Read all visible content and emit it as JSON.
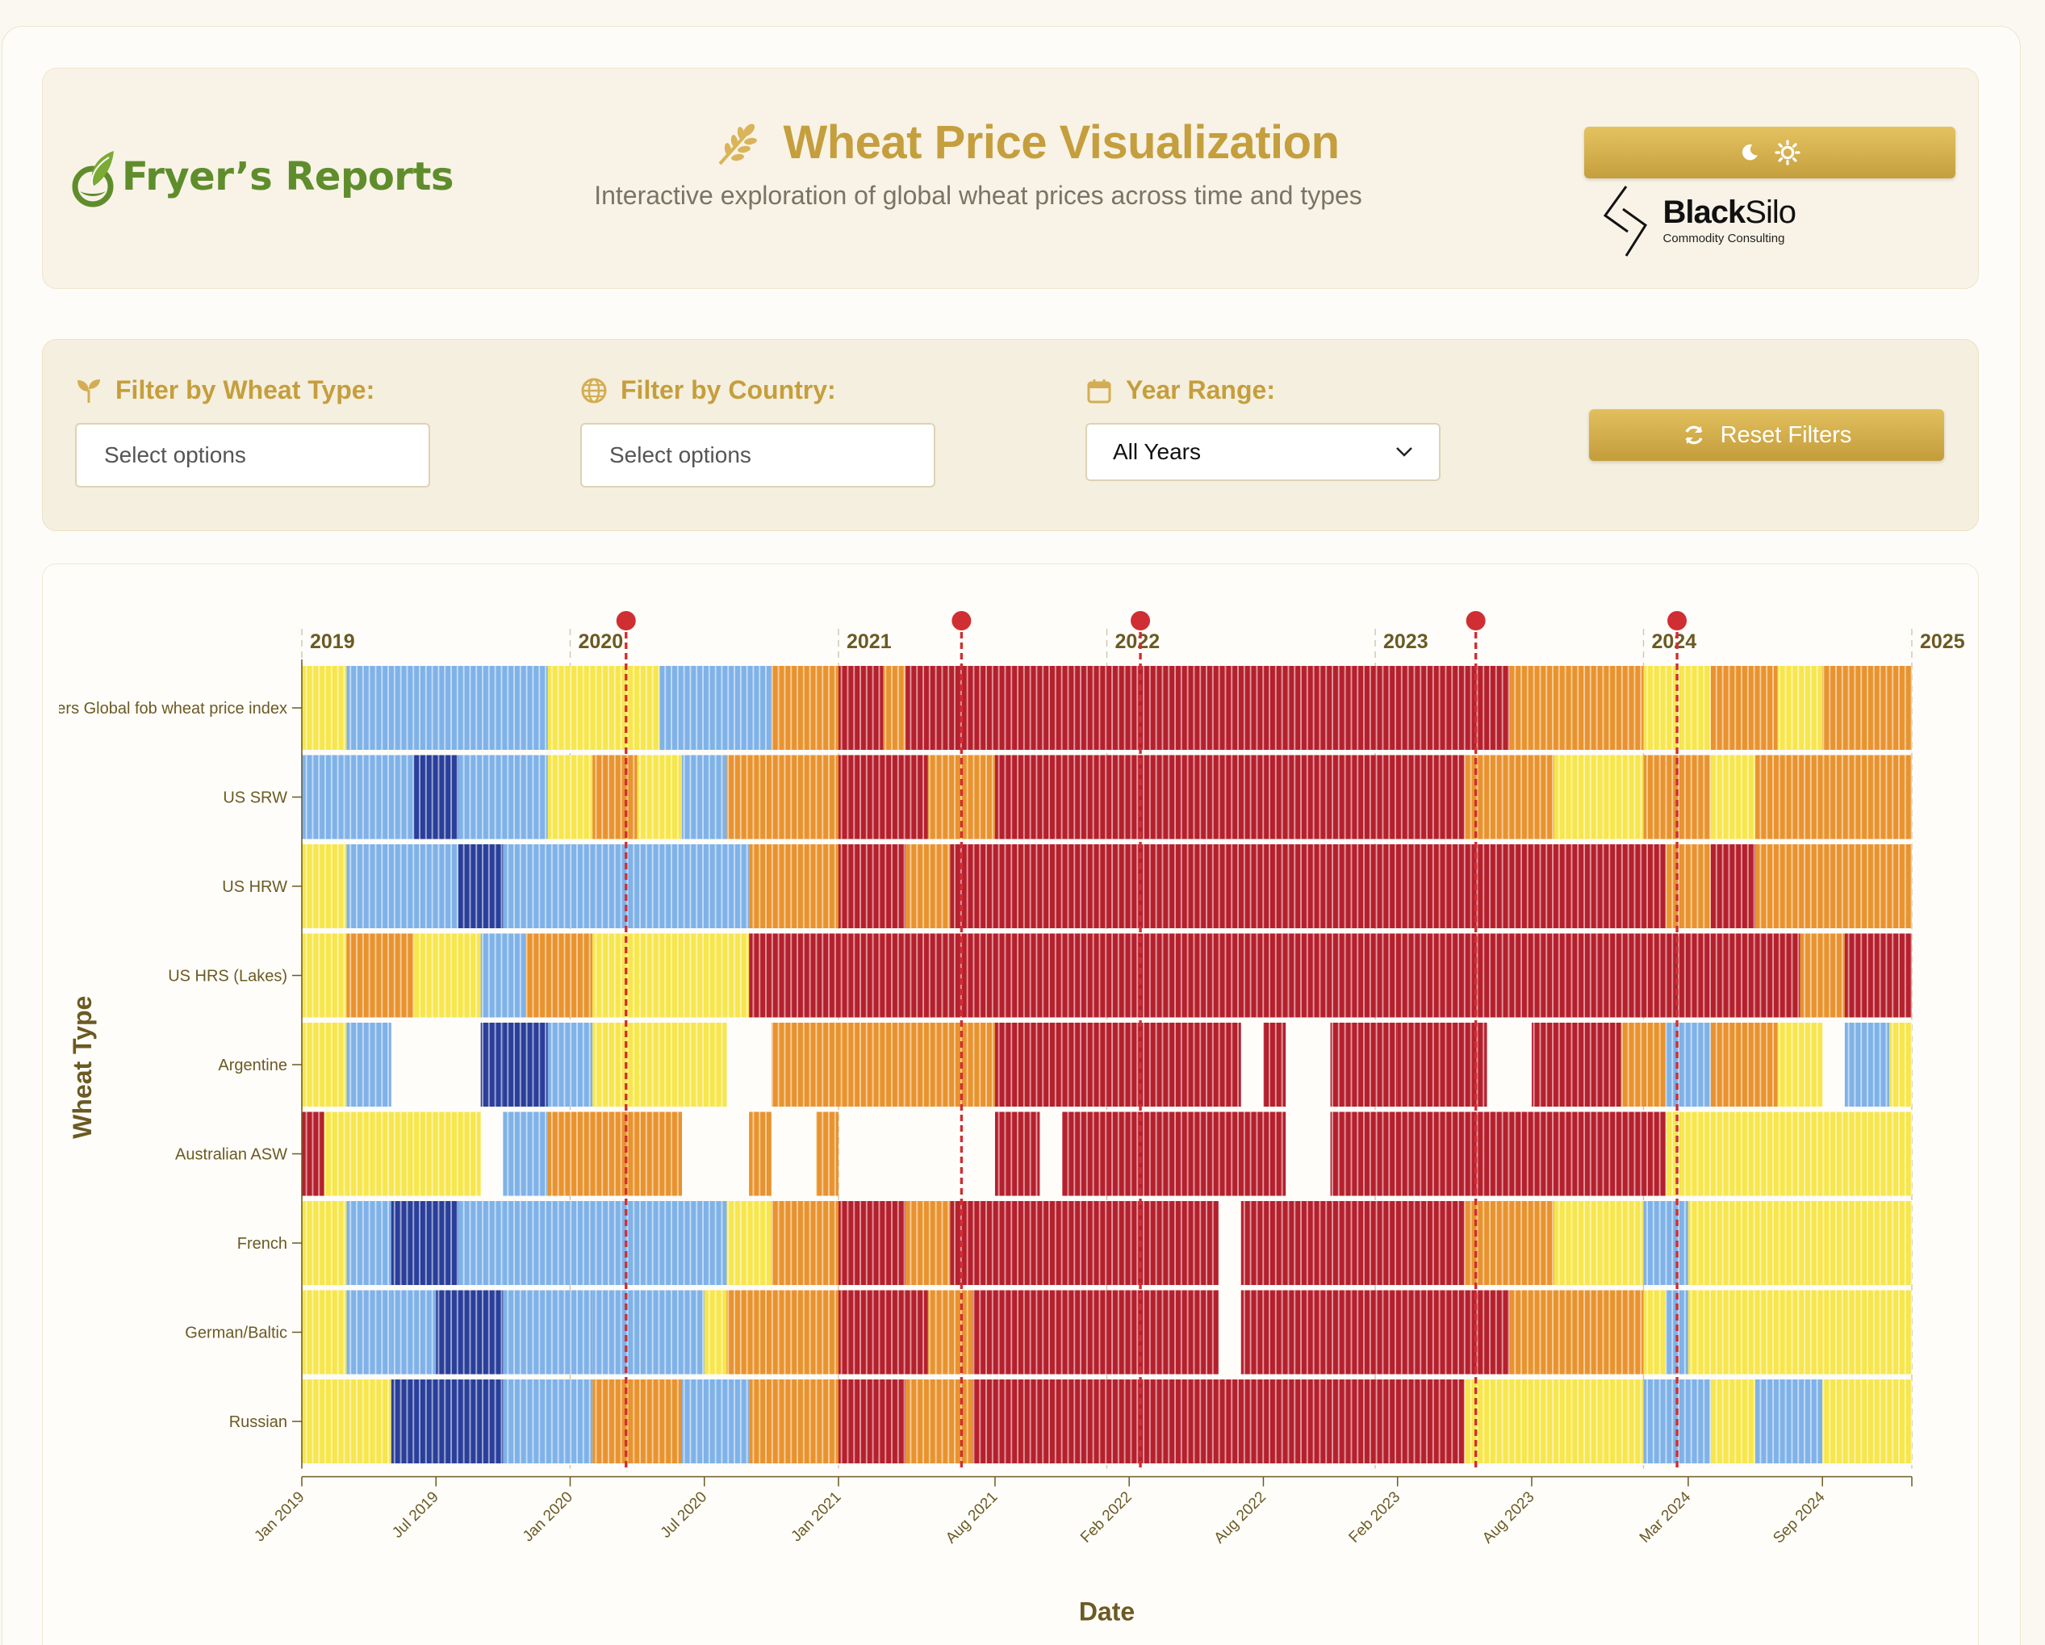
{
  "header": {
    "brand": "Fryer’s Reports",
    "title": "Wheat Price Visualization",
    "subtitle": "Interactive exploration of global wheat prices across time and types",
    "theme_toggle": {
      "moon_icon": "moon-icon",
      "sun_icon": "sun-icon"
    },
    "partner": {
      "name_bold": "Black",
      "name_light": "Silo",
      "tagline": "Commodity Consulting"
    }
  },
  "filters": {
    "wheat_type": {
      "label": "Filter by Wheat Type:",
      "placeholder": "Select options",
      "icon": "seedling-icon"
    },
    "country": {
      "label": "Filter by Country:",
      "placeholder": "Select options",
      "icon": "globe-icon"
    },
    "year_range": {
      "label": "Year Range:",
      "selected": "All Years",
      "icon": "calendar-icon"
    },
    "reset_label": "Reset Filters"
  },
  "colors": {
    "very_low": "#2a3f9a",
    "low": "#7fb2e8",
    "mid": "#f7e64c",
    "high": "#e9932e",
    "very_high": "#b5202d",
    "event_marker": "#cf2f33",
    "accent": "#c59e3d"
  },
  "chart_data": {
    "type": "heatmap",
    "ylabel": "Wheat Type",
    "xlabel": "Date",
    "rows": [
      "Fryers Global fob wheat price index",
      "US SRW",
      "US HRW",
      "US HRS (Lakes)",
      "Argentine",
      "Australian ASW",
      "French",
      "German/Baltic",
      "Russian"
    ],
    "x_range": [
      "2019-01",
      "2024-12"
    ],
    "year_labels": [
      "2019",
      "2020",
      "2021",
      "2022",
      "2023",
      "2024",
      "2025"
    ],
    "x_ticks": [
      "Jan 2019",
      "Jul 2019",
      "Jan 2020",
      "Jul 2020",
      "Jan 2021",
      "Aug 2021",
      "Feb 2022",
      "Aug 2022",
      "Feb 2023",
      "Aug 2023",
      "Mar 2024",
      "Sep 2024"
    ],
    "events": [
      "2020-03",
      "2021-06",
      "2022-02",
      "2023-05",
      "2024-02"
    ],
    "scale": [
      "very_low",
      "low",
      "mid",
      "high",
      "very_high"
    ],
    "segments": [
      [
        [
          "2019-01",
          "2019-03",
          "mid"
        ],
        [
          "2019-03",
          "2019-12",
          "low"
        ],
        [
          "2019-12",
          "2020-05",
          "mid"
        ],
        [
          "2020-05",
          "2020-10",
          "low"
        ],
        [
          "2020-10",
          "2021-01",
          "high"
        ],
        [
          "2021-01",
          "2021-03",
          "very_high"
        ],
        [
          "2021-03",
          "2021-04",
          "high"
        ],
        [
          "2021-04",
          "2023-07",
          "very_high"
        ],
        [
          "2023-07",
          "2024-01",
          "high"
        ],
        [
          "2024-01",
          "2024-04",
          "mid"
        ],
        [
          "2024-04",
          "2024-07",
          "high"
        ],
        [
          "2024-07",
          "2024-09",
          "mid"
        ],
        [
          "2024-09",
          "2025-01",
          "high"
        ]
      ],
      [
        [
          "2019-01",
          "2019-03",
          "low"
        ],
        [
          "2019-03",
          "2019-06",
          "low"
        ],
        [
          "2019-06",
          "2019-08",
          "very_low"
        ],
        [
          "2019-08",
          "2019-12",
          "low"
        ],
        [
          "2019-12",
          "2020-02",
          "mid"
        ],
        [
          "2020-02",
          "2020-04",
          "high"
        ],
        [
          "2020-04",
          "2020-06",
          "mid"
        ],
        [
          "2020-06",
          "2020-08",
          "low"
        ],
        [
          "2020-08",
          "2021-01",
          "high"
        ],
        [
          "2021-01",
          "2021-05",
          "very_high"
        ],
        [
          "2021-05",
          "2021-08",
          "high"
        ],
        [
          "2021-08",
          "2023-05",
          "very_high"
        ],
        [
          "2023-05",
          "2023-09",
          "high"
        ],
        [
          "2023-09",
          "2024-01",
          "mid"
        ],
        [
          "2024-01",
          "2024-04",
          "high"
        ],
        [
          "2024-04",
          "2024-06",
          "mid"
        ],
        [
          "2024-06",
          "2025-01",
          "high"
        ]
      ],
      [
        [
          "2019-01",
          "2019-03",
          "mid"
        ],
        [
          "2019-03",
          "2019-08",
          "low"
        ],
        [
          "2019-08",
          "2019-10",
          "very_low"
        ],
        [
          "2019-10",
          "2020-05",
          "low"
        ],
        [
          "2020-05",
          "2020-09",
          "low"
        ],
        [
          "2020-09",
          "2021-01",
          "high"
        ],
        [
          "2021-01",
          "2021-04",
          "very_high"
        ],
        [
          "2021-04",
          "2021-06",
          "high"
        ],
        [
          "2021-06",
          "2024-02",
          "very_high"
        ],
        [
          "2024-02",
          "2024-04",
          "high"
        ],
        [
          "2024-04",
          "2024-06",
          "very_high"
        ],
        [
          "2024-06",
          "2025-01",
          "high"
        ]
      ],
      [
        [
          "2019-01",
          "2019-03",
          "mid"
        ],
        [
          "2019-03",
          "2019-06",
          "high"
        ],
        [
          "2019-06",
          "2019-09",
          "mid"
        ],
        [
          "2019-09",
          "2019-11",
          "low"
        ],
        [
          "2019-11",
          "2020-02",
          "high"
        ],
        [
          "2020-02",
          "2020-06",
          "mid"
        ],
        [
          "2020-06",
          "2020-09",
          "mid"
        ],
        [
          "2020-09",
          "2021-01",
          "very_high"
        ],
        [
          "2021-01",
          "2024-06",
          "very_high"
        ],
        [
          "2024-06",
          "2024-08",
          "very_high"
        ],
        [
          "2024-08",
          "2024-10",
          "high"
        ],
        [
          "2024-10",
          "2025-01",
          "very_high"
        ]
      ],
      [
        [
          "2019-01",
          "2019-03",
          "mid"
        ],
        [
          "2019-03",
          "2019-05",
          "low"
        ],
        [
          "2019-09",
          "2019-10",
          "very_low"
        ],
        [
          "2019-10",
          "2019-12",
          "very_low"
        ],
        [
          "2019-12",
          "2020-02",
          "low"
        ],
        [
          "2020-02",
          "2020-03",
          "mid"
        ],
        [
          "2020-03",
          "2020-08",
          "mid"
        ],
        [
          "2020-10",
          "2021-04",
          "high"
        ],
        [
          "2021-04",
          "2021-08",
          "high"
        ],
        [
          "2021-08",
          "2022-07",
          "very_high"
        ],
        [
          "2022-08",
          "2022-09",
          "very_high"
        ],
        [
          "2022-11",
          "2023-02",
          "very_high"
        ],
        [
          "2023-02",
          "2023-06",
          "very_high"
        ],
        [
          "2023-08",
          "2023-12",
          "very_high"
        ],
        [
          "2023-12",
          "2024-02",
          "high"
        ],
        [
          "2024-02",
          "2024-04",
          "low"
        ],
        [
          "2024-04",
          "2024-07",
          "high"
        ],
        [
          "2024-07",
          "2024-09",
          "mid"
        ],
        [
          "2024-10",
          "2024-12",
          "low"
        ],
        [
          "2024-12",
          "2025-01",
          "mid"
        ]
      ],
      [
        [
          "2019-01",
          "2019-02",
          "very_high"
        ],
        [
          "2019-02",
          "2019-03",
          "mid"
        ],
        [
          "2019-03",
          "2019-06",
          "mid"
        ],
        [
          "2019-06",
          "2019-09",
          "mid"
        ],
        [
          "2019-10",
          "2019-12",
          "low"
        ],
        [
          "2019-12",
          "2020-06",
          "high"
        ],
        [
          "2020-09",
          "2020-10",
          "high"
        ],
        [
          "2020-12",
          "2021-01",
          "high"
        ],
        [
          "2021-08",
          "2021-09",
          "very_high"
        ],
        [
          "2021-09",
          "2021-10",
          "very_high"
        ],
        [
          "2021-11",
          "2022-09",
          "very_high"
        ],
        [
          "2022-11",
          "2024-01",
          "very_high"
        ],
        [
          "2024-01",
          "2024-02",
          "very_high"
        ],
        [
          "2024-02",
          "2024-06",
          "mid"
        ],
        [
          "2024-06",
          "2024-09",
          "mid"
        ],
        [
          "2024-09",
          "2025-01",
          "mid"
        ]
      ],
      [
        [
          "2019-01",
          "2019-03",
          "mid"
        ],
        [
          "2019-03",
          "2019-10",
          "low"
        ],
        [
          "2019-05",
          "2019-08",
          "very_low"
        ],
        [
          "2019-10",
          "2020-08",
          "low"
        ],
        [
          "2020-08",
          "2020-10",
          "mid"
        ],
        [
          "2020-10",
          "2021-01",
          "high"
        ],
        [
          "2021-01",
          "2021-04",
          "very_high"
        ],
        [
          "2021-04",
          "2021-06",
          "high"
        ],
        [
          "2021-06",
          "2022-06",
          "very_high"
        ],
        [
          "2022-07",
          "2023-05",
          "very_high"
        ],
        [
          "2023-05",
          "2023-09",
          "high"
        ],
        [
          "2023-09",
          "2024-01",
          "mid"
        ],
        [
          "2024-01",
          "2024-03",
          "low"
        ],
        [
          "2024-03",
          "2024-08",
          "mid"
        ],
        [
          "2024-08",
          "2025-01",
          "mid"
        ]
      ],
      [
        [
          "2019-01",
          "2019-03",
          "mid"
        ],
        [
          "2019-03",
          "2019-05",
          "low"
        ],
        [
          "2019-05",
          "2019-07",
          "low"
        ],
        [
          "2019-07",
          "2019-10",
          "very_low"
        ],
        [
          "2019-10",
          "2020-02",
          "low"
        ],
        [
          "2020-02",
          "2020-07",
          "low"
        ],
        [
          "2020-07",
          "2020-08",
          "mid"
        ],
        [
          "2020-08",
          "2021-01",
          "high"
        ],
        [
          "2021-01",
          "2021-05",
          "very_high"
        ],
        [
          "2021-05",
          "2021-07",
          "high"
        ],
        [
          "2021-07",
          "2022-06",
          "very_high"
        ],
        [
          "2022-07",
          "2023-07",
          "very_high"
        ],
        [
          "2023-07",
          "2024-01",
          "high"
        ],
        [
          "2024-01",
          "2024-02",
          "mid"
        ],
        [
          "2024-02",
          "2024-03",
          "low"
        ],
        [
          "2024-03",
          "2024-05",
          "mid"
        ],
        [
          "2024-05",
          "2025-01",
          "mid"
        ]
      ],
      [
        [
          "2019-01",
          "2019-03",
          "mid"
        ],
        [
          "2019-03",
          "2019-05",
          "mid"
        ],
        [
          "2019-05",
          "2019-10",
          "very_low"
        ],
        [
          "2019-10",
          "2020-02",
          "low"
        ],
        [
          "2020-02",
          "2020-06",
          "high"
        ],
        [
          "2020-06",
          "2020-09",
          "low"
        ],
        [
          "2020-09",
          "2021-01",
          "high"
        ],
        [
          "2021-01",
          "2021-04",
          "very_high"
        ],
        [
          "2021-04",
          "2021-07",
          "high"
        ],
        [
          "2021-07",
          "2023-05",
          "very_high"
        ],
        [
          "2023-05",
          "2023-09",
          "mid"
        ],
        [
          "2023-09",
          "2024-01",
          "mid"
        ],
        [
          "2024-01",
          "2024-04",
          "low"
        ],
        [
          "2024-04",
          "2024-06",
          "mid"
        ],
        [
          "2024-06",
          "2024-09",
          "low"
        ],
        [
          "2024-09",
          "2025-01",
          "mid"
        ]
      ]
    ]
  }
}
